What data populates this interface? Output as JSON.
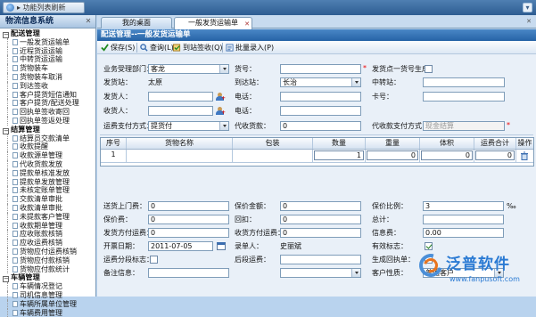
{
  "topbar": {
    "button_label": "▸ 功能列表刷新"
  },
  "sidebar": {
    "title": "物流信息系统",
    "groups": [
      {
        "label": "配送管理",
        "items": [
          "一般发货运输单",
          "近程货运运输",
          "中转货运运输",
          "货物装车",
          "货物装车取消",
          "到达签收",
          "客户提货短信通知",
          "客户提货/配送处理",
          "回执单签收寄回",
          "回执单签返处理"
        ]
      },
      {
        "label": "结算管理",
        "items": [
          "结算员交款清单",
          "收款提醒",
          "收款源单管理",
          "代收货款发放",
          "提款单核准发放",
          "提款单发放管理",
          "未核定账单管理",
          "交款清单审批",
          "收款清单审批",
          "未提款客户管理",
          "收款期单管理",
          "应收账款核销",
          "应收运费核销",
          "货物应付运费核销",
          "货物应付款核销",
          "货物应付款统计"
        ]
      },
      {
        "label": "车辆管理",
        "items": [
          "车辆情况登记",
          "司机信息管理",
          "车辆所属单位管理",
          "车辆费用管理"
        ]
      }
    ]
  },
  "tabs": [
    {
      "label": "我的桌面"
    },
    {
      "label": "一般发货运输单"
    }
  ],
  "main": {
    "title": "配送管理--一般发货运输单",
    "toolbar": {
      "save": "保存(S)",
      "query": "查询(L)",
      "arrive": "到站签收(Q)",
      "batch": "批量录入(P)"
    }
  },
  "form": {
    "dept_label": "业务受理部门：",
    "dept_value": "客龙",
    "goods_no_label": "货号：",
    "goods_no_value": "",
    "single_label": "发货点一货号生成",
    "send_station_label": "发货站：",
    "send_station_value": "太原",
    "arrive_station_label": "到达站：",
    "arrive_station_value": "长治",
    "transfer_label": "中转站：",
    "transfer_value": "",
    "sender_label": "发货人：",
    "sender_value": "",
    "sender_phone_label": "电话：",
    "sender_phone_value": "",
    "card_label": "卡号：",
    "card_value": "",
    "receiver_label": "收货人：",
    "receiver_value": "",
    "receiver_phone_label": "电话：",
    "receiver_phone_value": "",
    "pay_label": "运费支付方式：",
    "pay_value": "提货付",
    "cod_label": "代收货款：",
    "cod_value": "0",
    "cod_pay_label": "代收款支付方式：",
    "cod_pay_value": "现金结算",
    "delivery_fee_label": "送货上门费：",
    "delivery_fee_value": "0",
    "insured_amount_label": "保价金额：",
    "insured_amount_value": "0",
    "insured_ratio_label": "保价比例：",
    "insured_ratio_value": "3",
    "insured_ratio_unit": "‰",
    "insured_fee_label": "保价费：",
    "insured_fee_value": "0",
    "rebate_label": "回扣：",
    "rebate_value": "0",
    "total_label": "总计：",
    "total_value": "",
    "sender_pay_label": "发货方付运费：",
    "sender_pay_value": "0",
    "receiver_pay_label": "收货方付运费：",
    "receiver_pay_value": "0",
    "info_fee_label": "信息费：",
    "info_fee_value": "0.00",
    "date_label": "开票日期：",
    "date_value": "2011-07-05",
    "entry_label": "录单人：",
    "entry_value": "史丽斌",
    "valid_label": "有效标志：",
    "segment_label": "运费分段标志：",
    "post_fee_label": "后段运费：",
    "post_fee_value": "",
    "receipt_label": "生成回执单：",
    "remark_label": "备注信息：",
    "remark_value": "",
    "customer_type_label": "客户性质：",
    "customer_type_value": "普通客户"
  },
  "grid": {
    "headers": [
      "序号",
      "货物名称",
      "包装",
      "数量",
      "重量",
      "体积",
      "运费合计",
      "操作"
    ],
    "rows": [
      {
        "no": "1",
        "name": "",
        "pack": "",
        "qty": "1",
        "weight": "0",
        "volume": "0",
        "fee": "0"
      }
    ]
  },
  "logo": {
    "text": "泛普软件",
    "url": "www.fanpusoft.com"
  }
}
